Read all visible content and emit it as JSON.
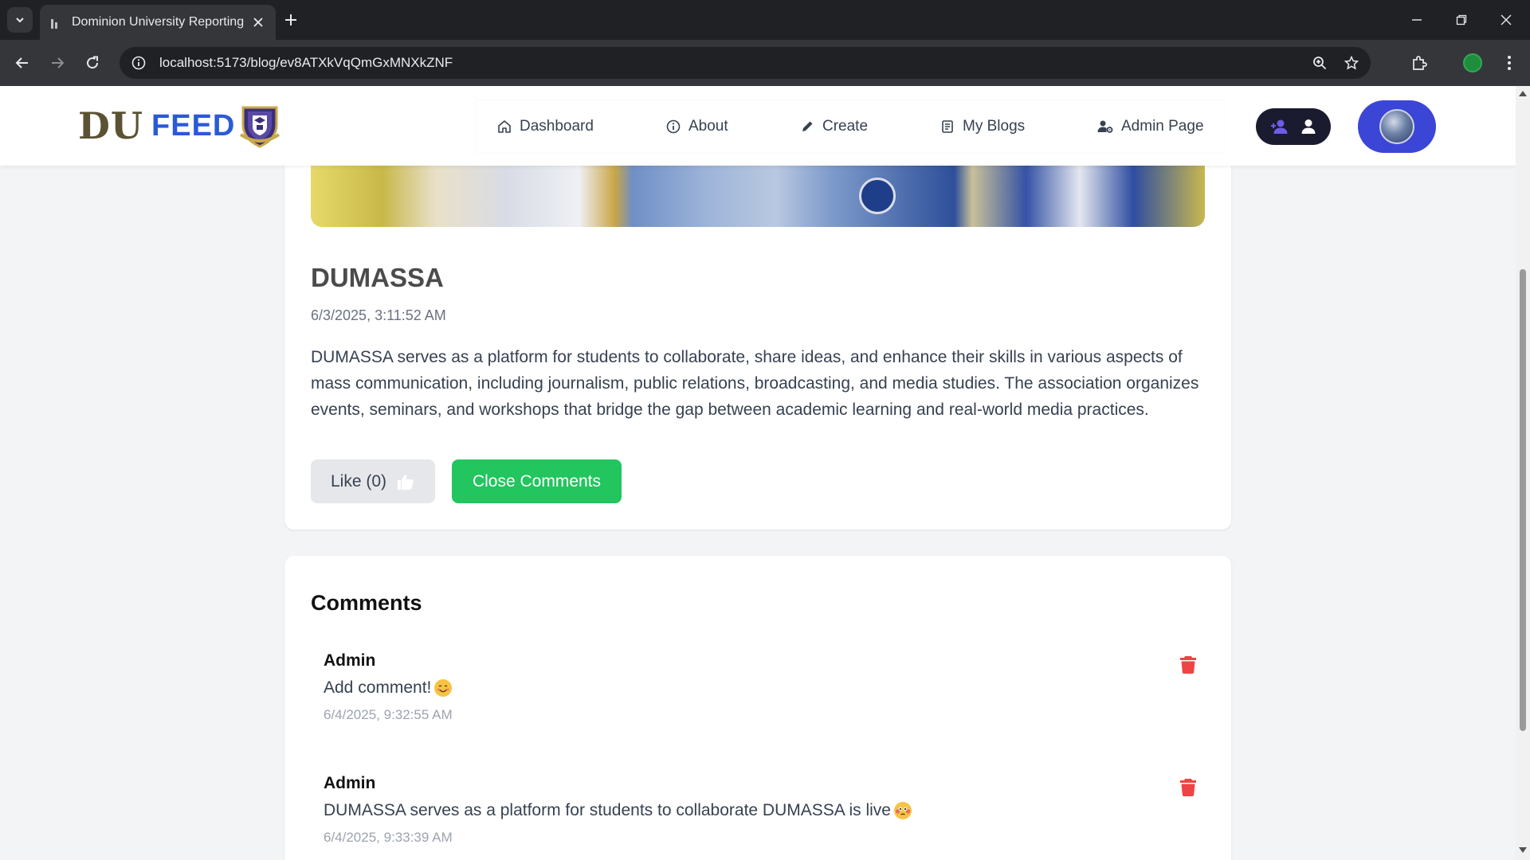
{
  "browser": {
    "tab_title": "Dominion University Reporting",
    "url": "localhost:5173/blog/ev8ATXkVqQmGxMNXkZNF"
  },
  "site": {
    "logo_du": "DU",
    "logo_feed": "FEED",
    "nav": {
      "dashboard": "Dashboard",
      "about": "About",
      "create": "Create",
      "my_blogs": "My Blogs",
      "admin_page": "Admin Page"
    },
    "colors": {
      "accent_blue": "#3b46d6",
      "green": "#22c55e",
      "delete_red": "#ef4444"
    }
  },
  "post": {
    "title": "DUMASSA",
    "date": "6/3/2025, 3:11:52 AM",
    "body": "DUMASSA serves as a platform for students to collaborate, share ideas, and enhance their skills in various aspects of mass communication, including journalism, public relations, broadcasting, and media studies. The association organizes events, seminars, and workshops that bridge the gap between academic learning and real-world media practices.",
    "like_label": "Like (0)",
    "close_comments_label": "Close Comments"
  },
  "comments": {
    "heading": "Comments",
    "items": [
      {
        "author": "Admin",
        "text": "Add comment!",
        "emoji": "smiling-face",
        "time": "6/4/2025, 9:32:55 AM"
      },
      {
        "author": "Admin",
        "text": "DUMASSA serves as a platform for students to collaborate DUMASSA is live",
        "emoji": "flushed-face",
        "time": "6/4/2025, 9:33:39 AM"
      }
    ]
  }
}
